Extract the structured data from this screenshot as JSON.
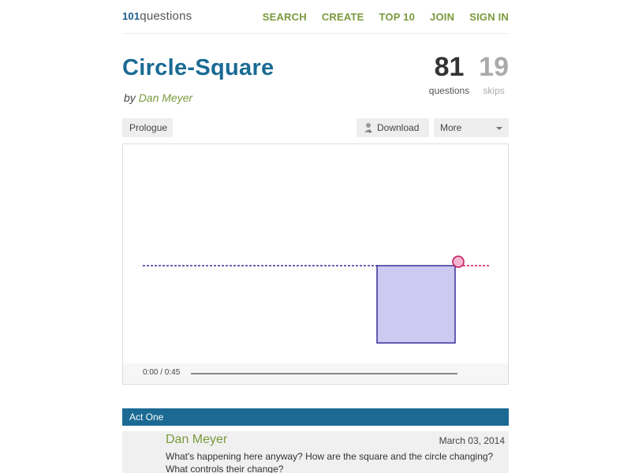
{
  "logo": {
    "number": "101",
    "word": "questions"
  },
  "nav": {
    "search": "SEARCH",
    "create": "CREATE",
    "top10": "TOP 10",
    "join": "JOIN",
    "signin": "SIGN IN"
  },
  "question": {
    "title": "Circle-Square",
    "by_prefix": "by",
    "author": "Dan Meyer"
  },
  "stats": {
    "questions_value": "81",
    "questions_label": "questions",
    "skips_value": "19",
    "skips_label": "skips"
  },
  "toolbar": {
    "prologue_label": "Prologue",
    "download_label": "Download",
    "more_label": "More"
  },
  "video": {
    "timecode": "0:00 / 0:45",
    "progress": 0
  },
  "act": {
    "label": "Act One"
  },
  "comment": {
    "name": "Dan Meyer",
    "date": "March 03, 2014",
    "text": "What's happening here anyway? How are the square and the circle changing? What controls their change?"
  },
  "colors": {
    "brand_blue": "#1a6a94",
    "nav_green": "#7a9a3c",
    "square_fill": "#cdc9f0",
    "square_stroke": "#3a2f9a",
    "circle_fill": "#f3b5cf",
    "circle_stroke": "#c2185b"
  },
  "icons": {
    "download": "download-icon",
    "more": "chevron-down-icon"
  }
}
